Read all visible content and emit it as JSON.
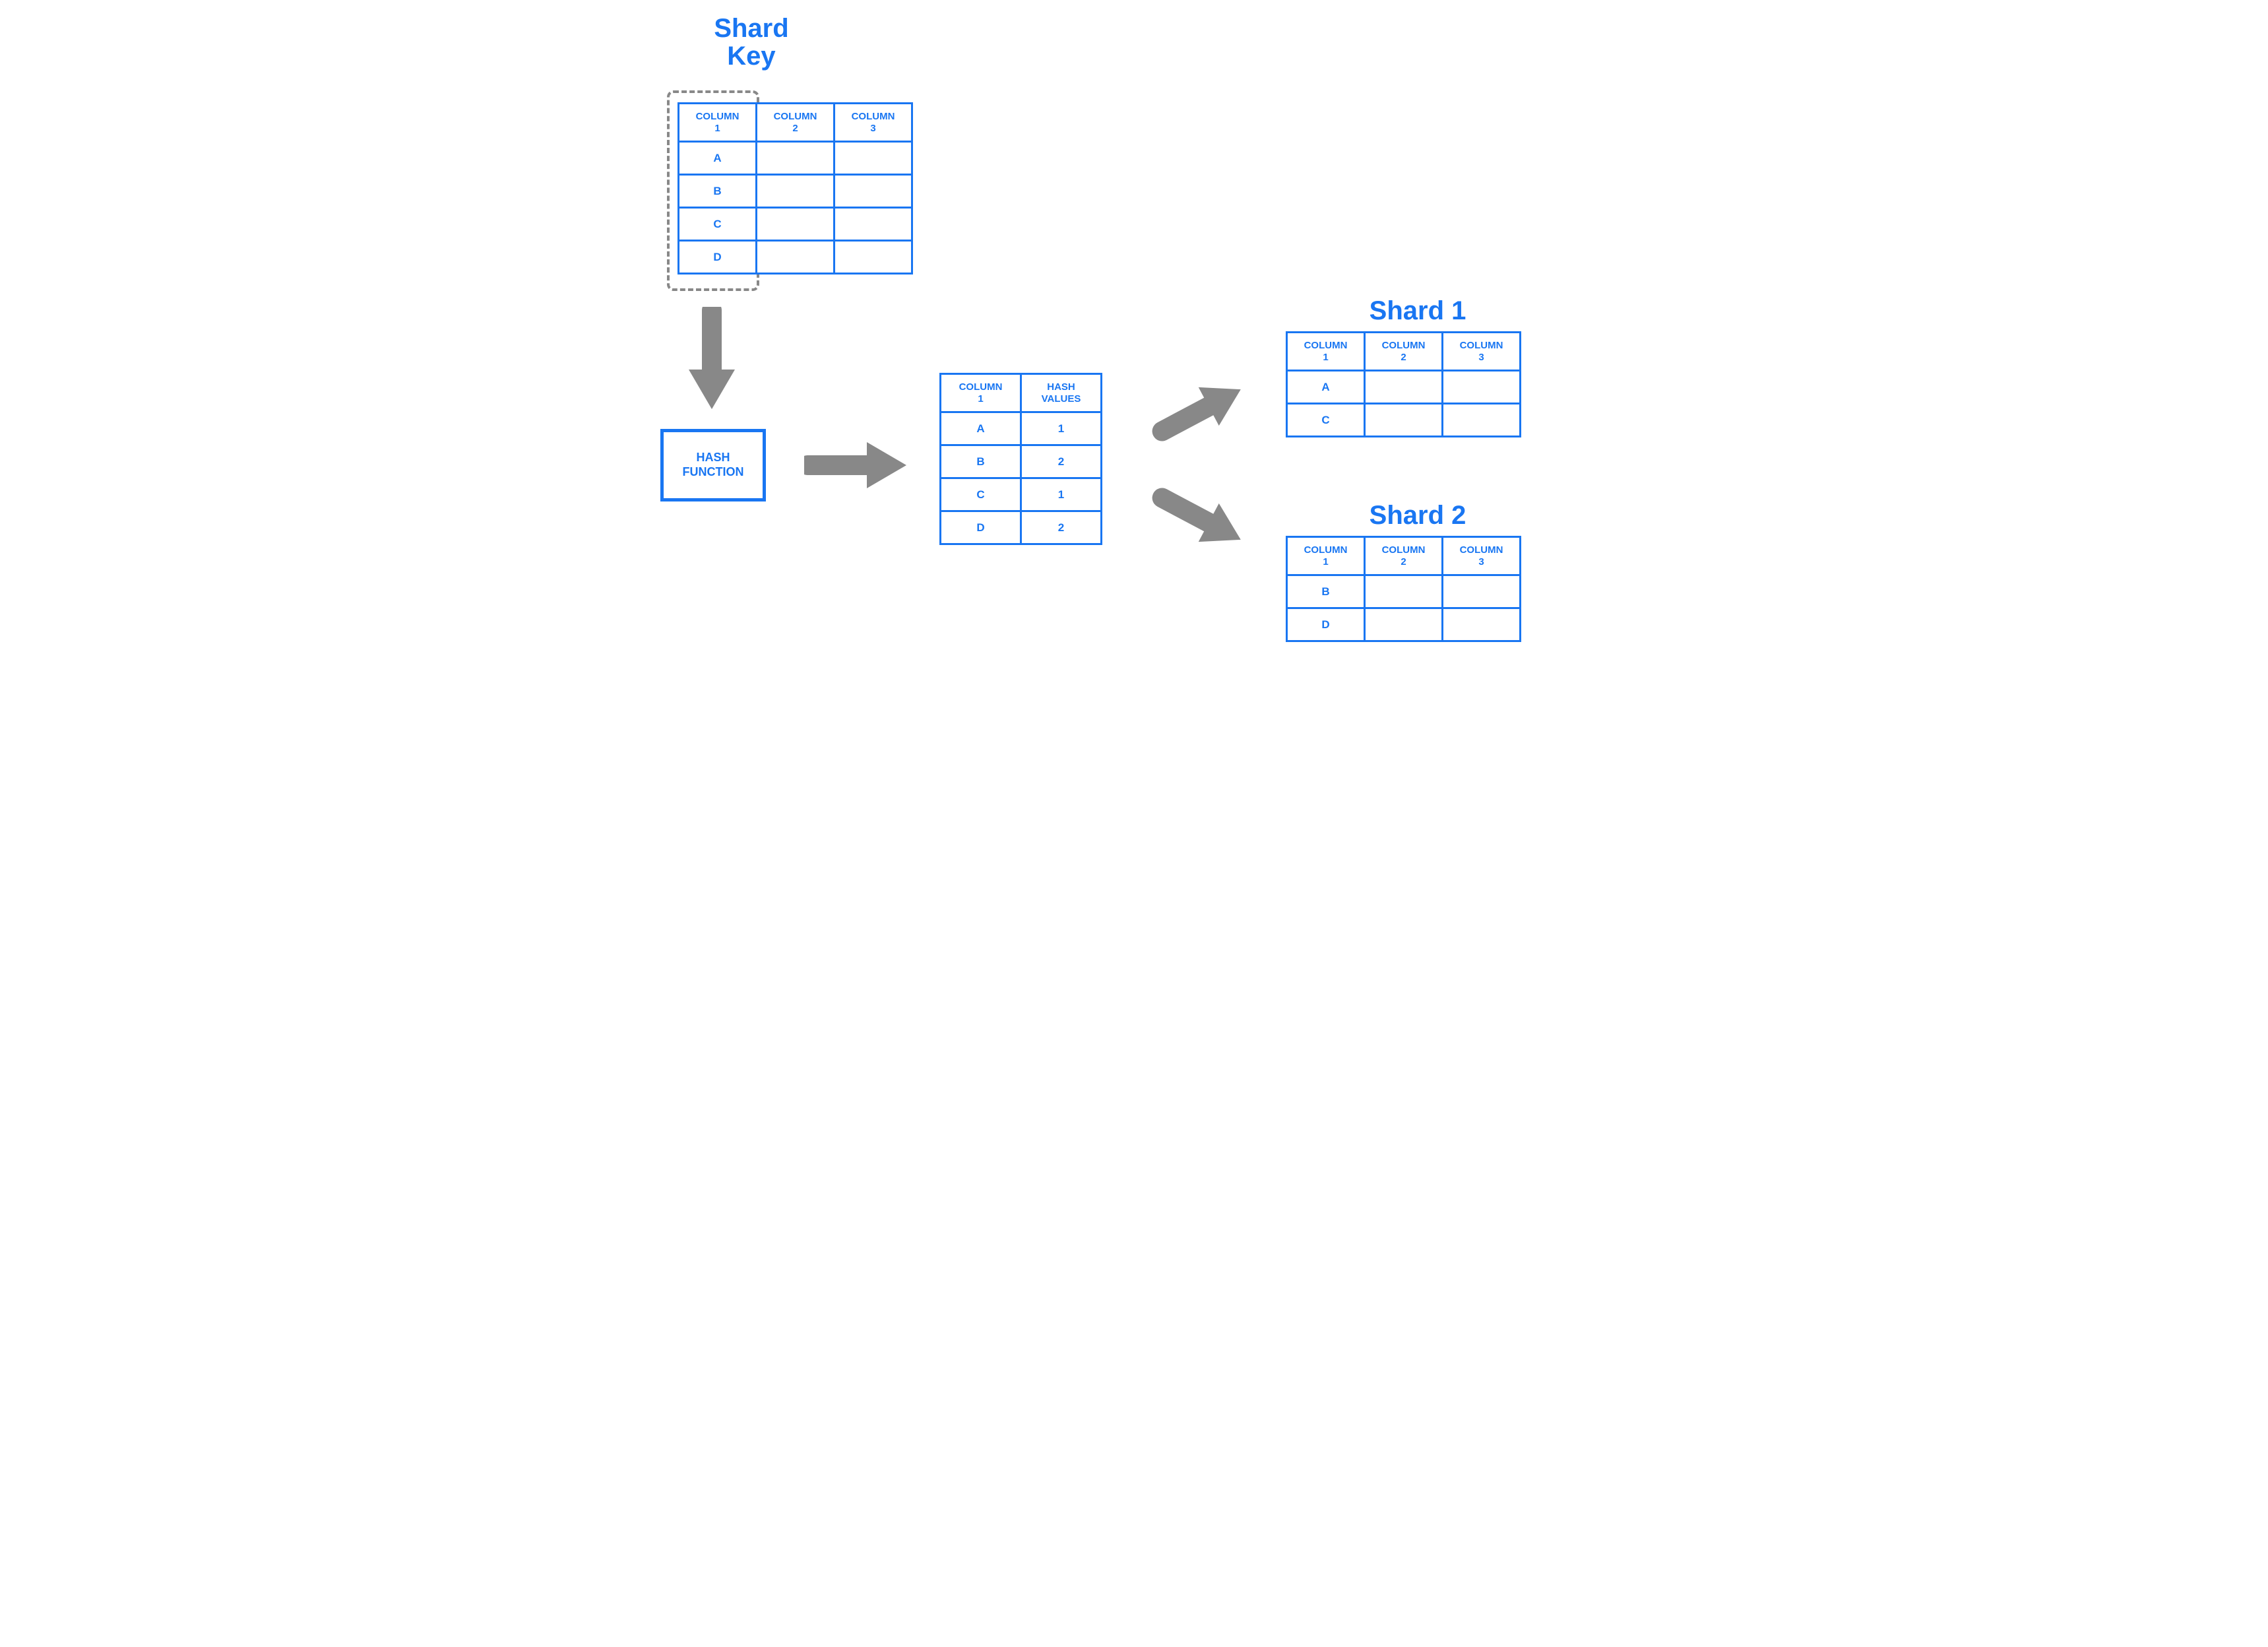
{
  "titles": {
    "shard_key_line1": "Shard",
    "shard_key_line2": "Key",
    "shard1": "Shard 1",
    "shard2": "Shard 2"
  },
  "source_table": {
    "headers": {
      "c1l1": "COLUMN",
      "c1l2": "1",
      "c2l1": "COLUMN",
      "c2l2": "2",
      "c3l1": "COLUMN",
      "c3l2": "3"
    },
    "rows": {
      "r1c1": "A",
      "r2c1": "B",
      "r3c1": "C",
      "r4c1": "D"
    }
  },
  "hash_function": {
    "line1": "HASH",
    "line2": "FUNCTION"
  },
  "hash_table": {
    "headers": {
      "c1l1": "COLUMN",
      "c1l2": "1",
      "c2l1": "HASH",
      "c2l2": "VALUES"
    },
    "rows": {
      "r1c1": "A",
      "r1c2": "1",
      "r2c1": "B",
      "r2c2": "2",
      "r3c1": "C",
      "r3c2": "1",
      "r4c1": "D",
      "r4c2": "2"
    }
  },
  "shard1_table": {
    "headers": {
      "c1l1": "COLUMN",
      "c1l2": "1",
      "c2l1": "COLUMN",
      "c2l2": "2",
      "c3l1": "COLUMN",
      "c3l2": "3"
    },
    "rows": {
      "r1c1": "A",
      "r2c1": "C"
    }
  },
  "shard2_table": {
    "headers": {
      "c1l1": "COLUMN",
      "c1l2": "1",
      "c2l1": "COLUMN",
      "c2l2": "2",
      "c3l1": "COLUMN",
      "c3l2": "3"
    },
    "rows": {
      "r1c1": "B",
      "r2c1": "D"
    }
  }
}
